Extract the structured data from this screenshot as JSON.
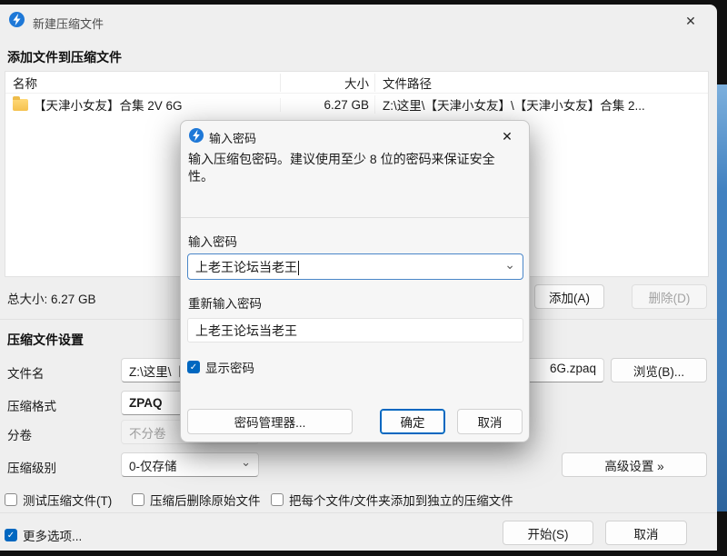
{
  "window": {
    "title": "新建压缩文件",
    "add_section_title": "添加文件到压缩文件",
    "table": {
      "columns": {
        "name": "名称",
        "size": "大小",
        "path": "文件路径"
      },
      "rows": [
        {
          "name": "【天津小女友】合集 2V 6G",
          "size": "6.27 GB",
          "path": "Z:\\这里\\【天津小女友】\\【天津小女友】合集 2..."
        }
      ]
    },
    "total_size_label": "总大小: 6.27 GB",
    "settings_section_title": "压缩文件设置",
    "fields": {
      "filename_label": "文件名",
      "filename_value_start": "Z:\\这里\\【",
      "filename_value_end": "6G.zpaq",
      "format_label": "压缩格式",
      "format_value": "ZPAQ",
      "volume_label": "分卷",
      "volume_value": "不分卷",
      "level_label": "压缩级别",
      "level_value": "0-仅存储"
    },
    "buttons": {
      "add": "添加(A)",
      "delete": "删除(D)",
      "browse": "浏览(B)...",
      "advanced": "高级设置 »",
      "start": "开始(S)",
      "cancel": "取消"
    },
    "options": {
      "test": "测试压缩文件(T)",
      "delete_after": "压缩后删除原始文件",
      "separate": "把每个文件/文件夹添加到独立的压缩文件",
      "more": "更多选项..."
    }
  },
  "dialog": {
    "title": "输入密码",
    "description": "输入压缩包密码。建议使用至少 8 位的密码来保证安全性。",
    "password_label": "输入密码",
    "password_value": "上老王论坛当老王",
    "confirm_label": "重新输入密码",
    "confirm_value": "上老王论坛当老王",
    "show_password": "显示密码",
    "buttons": {
      "manager": "密码管理器...",
      "ok": "确定",
      "cancel": "取消"
    }
  },
  "icons": {
    "app": "zip-app-icon",
    "folder": "folder-icon",
    "close": "✕",
    "chevron_down": "⌄",
    "check": "✓"
  },
  "colors": {
    "accent": "#0067c0",
    "desktop_blue": "#4181c0"
  }
}
